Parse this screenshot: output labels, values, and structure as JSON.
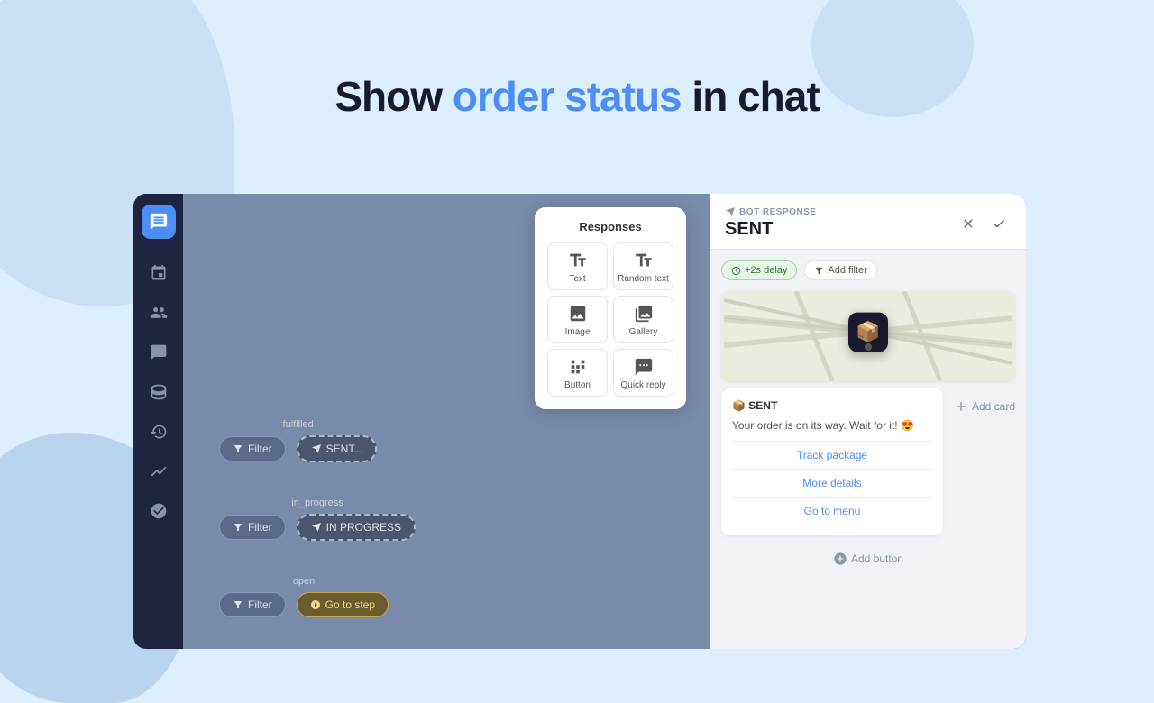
{
  "heading": {
    "prefix": "Show ",
    "highlight": "order status",
    "suffix": " in chat"
  },
  "sidebar": {
    "logo_icon": "chat-icon",
    "items": [
      {
        "name": "flows-icon",
        "symbol": "⊞"
      },
      {
        "name": "contacts-icon",
        "symbol": "👥"
      },
      {
        "name": "conversations-icon",
        "symbol": "💬"
      },
      {
        "name": "database-icon",
        "symbol": "🗄"
      },
      {
        "name": "history-icon",
        "symbol": "🕐"
      },
      {
        "name": "analytics-icon",
        "symbol": "📈"
      },
      {
        "name": "settings-icon",
        "symbol": "⚙"
      }
    ]
  },
  "responses_panel": {
    "title": "Responses",
    "items": [
      {
        "name": "text-response",
        "label": "Text"
      },
      {
        "name": "random-text-response",
        "label": "Random text"
      },
      {
        "name": "image-response",
        "label": "Image"
      },
      {
        "name": "gallery-response",
        "label": "Gallery"
      },
      {
        "name": "button-response",
        "label": "Button"
      },
      {
        "name": "quick-reply-response",
        "label": "Quick reply"
      }
    ]
  },
  "flow": {
    "sections": [
      {
        "id": "fulfilled",
        "label": "fulfilled",
        "filter_label": "Filter",
        "node_label": "SENT..."
      },
      {
        "id": "in_progress",
        "label": "in_progress",
        "filter_label": "Filter",
        "node_label": "IN PROGRESS"
      },
      {
        "id": "open",
        "label": "open",
        "filter_label": "Filter",
        "node_label": "Go to step"
      }
    ]
  },
  "bot_panel": {
    "tag": "BOT RESPONSE",
    "title": "SENT",
    "delay_label": "+2s delay",
    "filter_label": "Add filter",
    "close_label": "×",
    "check_label": "✓",
    "map_emoji": "📦",
    "message_title": "📦 SENT",
    "message_text": "Your order is on its way. Wait for it! 😍",
    "buttons": [
      {
        "label": "Track package"
      },
      {
        "label": "More details"
      },
      {
        "label": "Go to menu"
      }
    ],
    "add_card_label": "Add card",
    "add_button_label": "Add button"
  }
}
